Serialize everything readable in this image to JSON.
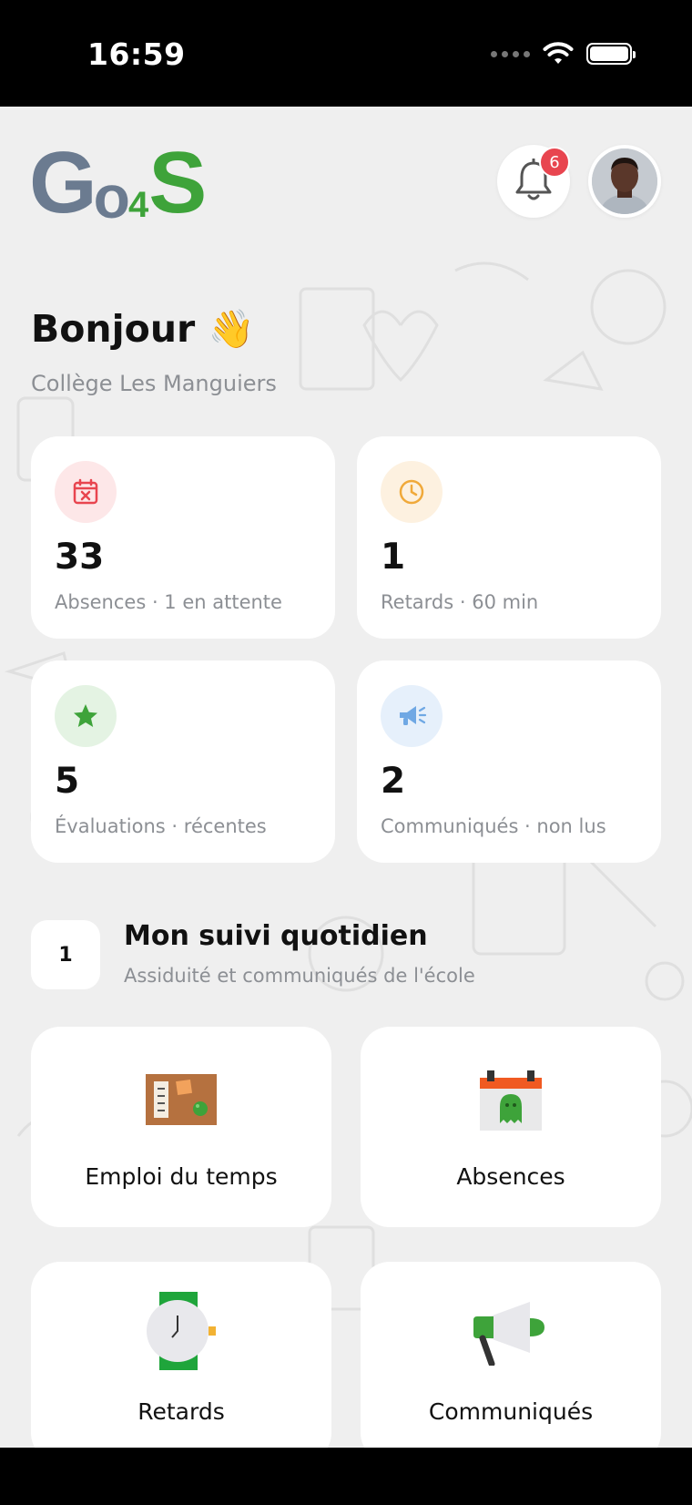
{
  "status_bar": {
    "time": "16:59"
  },
  "header": {
    "logo": {
      "g": "G",
      "o": "o",
      "four": "4",
      "s": "S"
    },
    "notification_count": "6"
  },
  "greeting": {
    "title": "Bonjour 👋",
    "school": "Collège Les Manguiers"
  },
  "stats": [
    {
      "value": "33",
      "label": "Absences · 1 en attente",
      "icon": "calendar-x-icon",
      "color": "#e8454f"
    },
    {
      "value": "1",
      "label": "Retards · 60 min",
      "icon": "clock-icon",
      "color": "#f0a93a"
    },
    {
      "value": "5",
      "label": "Évaluations · récentes",
      "icon": "star-icon",
      "color": "#3ea33a"
    },
    {
      "value": "2",
      "label": "Communiqués · non lus",
      "icon": "megaphone-icon",
      "color": "#6fa8e4"
    }
  ],
  "section": {
    "number": "1",
    "title": "Mon suivi quotidien",
    "subtitle": "Assiduité et communiqués de l'école"
  },
  "tiles": [
    {
      "label": "Emploi du temps",
      "icon": "corkboard-icon"
    },
    {
      "label": "Absences",
      "icon": "calendar-ghost-icon"
    },
    {
      "label": "Retards",
      "icon": "watch-icon"
    },
    {
      "label": "Communiqués",
      "icon": "megaphone-icon"
    }
  ]
}
